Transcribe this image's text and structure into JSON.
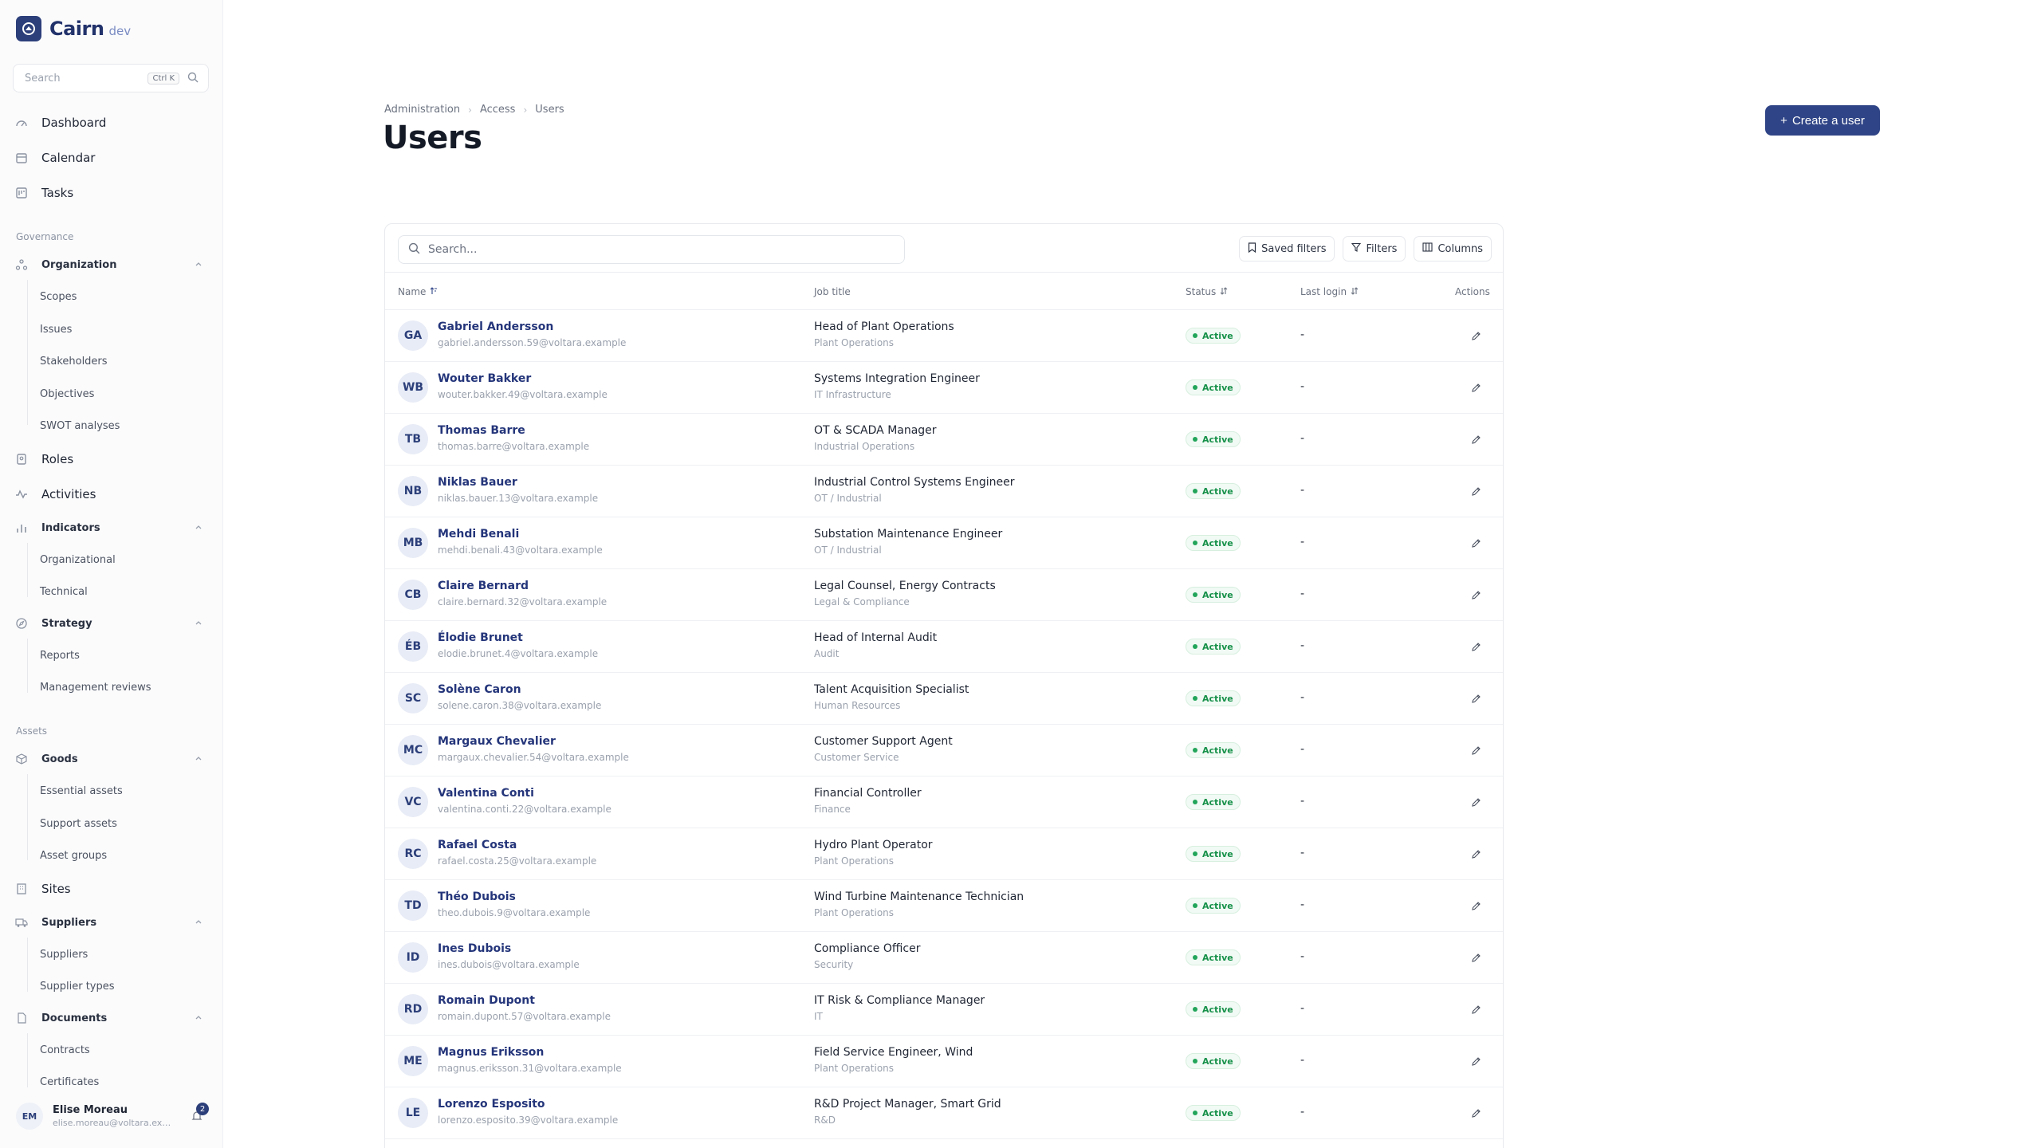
{
  "app": {
    "name": "Cairn",
    "env": "dev"
  },
  "sidebar": {
    "search_placeholder": "Search",
    "search_shortcut": "Ctrl K",
    "top_items": [
      {
        "label": "Dashboard",
        "icon": "dashboard-icon"
      },
      {
        "label": "Calendar",
        "icon": "calendar-icon"
      },
      {
        "label": "Tasks",
        "icon": "tasks-icon"
      }
    ],
    "sections": {
      "governance": "Governance",
      "assets": "Assets"
    },
    "organization": {
      "label": "Organization",
      "children": [
        "Scopes",
        "Issues",
        "Stakeholders",
        "Objectives",
        "SWOT analyses"
      ]
    },
    "roles": "Roles",
    "activities": "Activities",
    "indicators": {
      "label": "Indicators",
      "children": [
        "Organizational",
        "Technical"
      ]
    },
    "strategy": {
      "label": "Strategy",
      "children": [
        "Reports",
        "Management reviews"
      ]
    },
    "goods": {
      "label": "Goods",
      "children": [
        "Essential assets",
        "Support assets",
        "Asset groups"
      ]
    },
    "sites": "Sites",
    "suppliers": {
      "label": "Suppliers",
      "children": [
        "Suppliers",
        "Supplier types"
      ]
    },
    "documents": {
      "label": "Documents",
      "children": [
        "Contracts",
        "Certificates"
      ]
    },
    "user": {
      "initials": "EM",
      "name": "Elise Moreau",
      "email": "elise.moreau@voltara.example",
      "notifications": "2"
    }
  },
  "breadcrumb": [
    "Administration",
    "Access",
    "Users"
  ],
  "page_title": "Users",
  "create_button": "Create a user",
  "toolbar": {
    "search_placeholder": "Search...",
    "saved_filters": "Saved filters",
    "filters": "Filters",
    "columns": "Columns"
  },
  "table": {
    "headers": {
      "name": "Name",
      "job": "Job title",
      "status": "Status",
      "last_login": "Last login",
      "actions": "Actions"
    },
    "rows": [
      {
        "initials": "GA",
        "name": "Gabriel Andersson",
        "email": "gabriel.andersson.59@voltara.example",
        "job": "Head of Plant Operations",
        "dept": "Plant Operations",
        "status": "Active",
        "last_login": "-"
      },
      {
        "initials": "WB",
        "name": "Wouter Bakker",
        "email": "wouter.bakker.49@voltara.example",
        "job": "Systems Integration Engineer",
        "dept": "IT Infrastructure",
        "status": "Active",
        "last_login": "-"
      },
      {
        "initials": "TB",
        "name": "Thomas Barre",
        "email": "thomas.barre@voltara.example",
        "job": "OT & SCADA Manager",
        "dept": "Industrial Operations",
        "status": "Active",
        "last_login": "-"
      },
      {
        "initials": "NB",
        "name": "Niklas Bauer",
        "email": "niklas.bauer.13@voltara.example",
        "job": "Industrial Control Systems Engineer",
        "dept": "OT / Industrial",
        "status": "Active",
        "last_login": "-"
      },
      {
        "initials": "MB",
        "name": "Mehdi Benali",
        "email": "mehdi.benali.43@voltara.example",
        "job": "Substation Maintenance Engineer",
        "dept": "OT / Industrial",
        "status": "Active",
        "last_login": "-"
      },
      {
        "initials": "CB",
        "name": "Claire Bernard",
        "email": "claire.bernard.32@voltara.example",
        "job": "Legal Counsel, Energy Contracts",
        "dept": "Legal & Compliance",
        "status": "Active",
        "last_login": "-"
      },
      {
        "initials": "ÉB",
        "name": "Élodie Brunet",
        "email": "elodie.brunet.4@voltara.example",
        "job": "Head of Internal Audit",
        "dept": "Audit",
        "status": "Active",
        "last_login": "-"
      },
      {
        "initials": "SC",
        "name": "Solène Caron",
        "email": "solene.caron.38@voltara.example",
        "job": "Talent Acquisition Specialist",
        "dept": "Human Resources",
        "status": "Active",
        "last_login": "-"
      },
      {
        "initials": "MC",
        "name": "Margaux Chevalier",
        "email": "margaux.chevalier.54@voltara.example",
        "job": "Customer Support Agent",
        "dept": "Customer Service",
        "status": "Active",
        "last_login": "-"
      },
      {
        "initials": "VC",
        "name": "Valentina Conti",
        "email": "valentina.conti.22@voltara.example",
        "job": "Financial Controller",
        "dept": "Finance",
        "status": "Active",
        "last_login": "-"
      },
      {
        "initials": "RC",
        "name": "Rafael Costa",
        "email": "rafael.costa.25@voltara.example",
        "job": "Hydro Plant Operator",
        "dept": "Plant Operations",
        "status": "Active",
        "last_login": "-"
      },
      {
        "initials": "TD",
        "name": "Théo Dubois",
        "email": "theo.dubois.9@voltara.example",
        "job": "Wind Turbine Maintenance Technician",
        "dept": "Plant Operations",
        "status": "Active",
        "last_login": "-"
      },
      {
        "initials": "ID",
        "name": "Ines Dubois",
        "email": "ines.dubois@voltara.example",
        "job": "Compliance Officer",
        "dept": "Security",
        "status": "Active",
        "last_login": "-"
      },
      {
        "initials": "RD",
        "name": "Romain Dupont",
        "email": "romain.dupont.57@voltara.example",
        "job": "IT Risk & Compliance Manager",
        "dept": "IT",
        "status": "Active",
        "last_login": "-"
      },
      {
        "initials": "ME",
        "name": "Magnus Eriksson",
        "email": "magnus.eriksson.31@voltara.example",
        "job": "Field Service Engineer, Wind",
        "dept": "Plant Operations",
        "status": "Active",
        "last_login": "-"
      },
      {
        "initials": "LE",
        "name": "Lorenzo Esposito",
        "email": "lorenzo.esposito.39@voltara.example",
        "job": "R&D Project Manager, Smart Grid",
        "dept": "R&D",
        "status": "Active",
        "last_login": "-"
      }
    ]
  },
  "colors": {
    "brand": "#2c3f7a",
    "accent_button": "#2f4486",
    "status_active": "#17914a",
    "link": "#24357a"
  }
}
